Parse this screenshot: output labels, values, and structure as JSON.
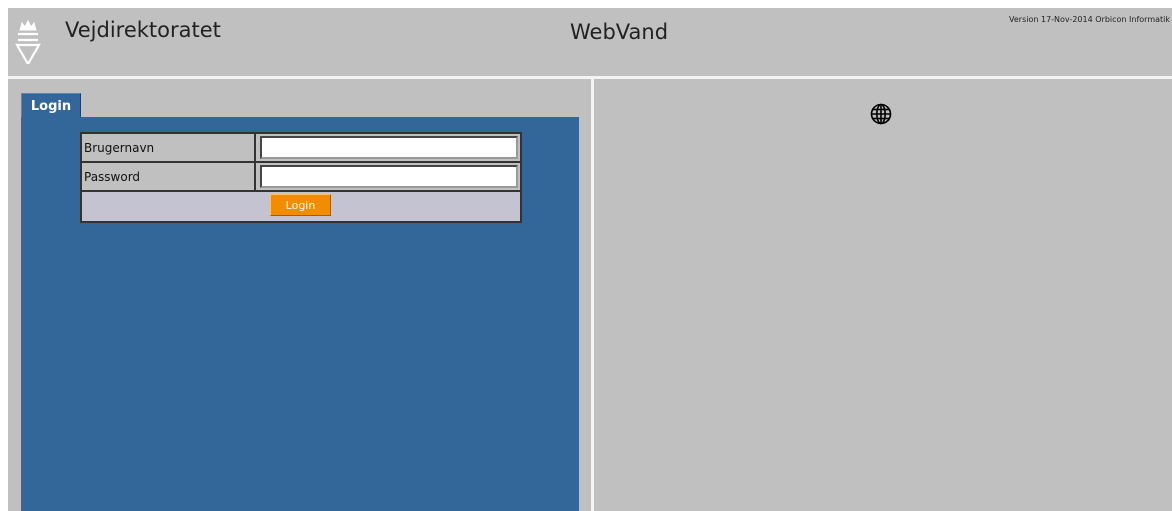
{
  "header": {
    "org_name": "Vejdirektoratet",
    "app_name": "WebVand",
    "version": "Version 17-Nov-2014 Orbicon Informatik",
    "logo_icon": "crown-triangle-icon"
  },
  "login_panel": {
    "tab_label": "Login",
    "username_label": "Brugernavn",
    "username_value": "",
    "password_label": "Password",
    "password_value": "",
    "submit_label": "Login"
  },
  "map_panel": {
    "icon": "globe-icon"
  },
  "colors": {
    "panel_blue": "#336699",
    "background_gray": "#c0c0c0",
    "button_orange": "#f28c00"
  }
}
